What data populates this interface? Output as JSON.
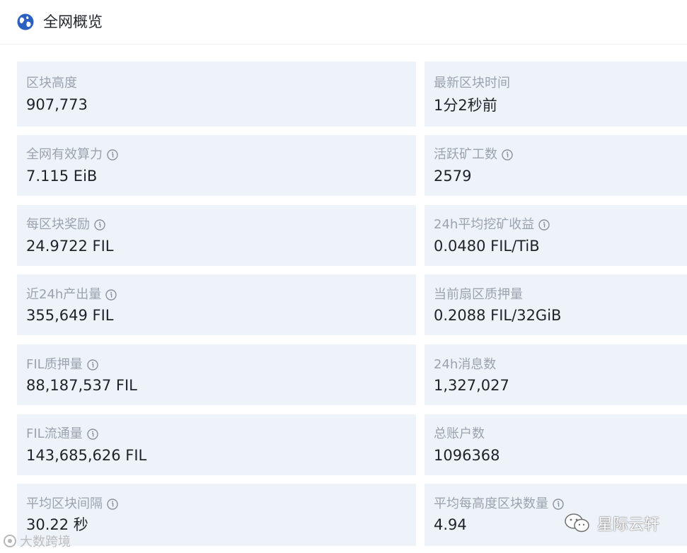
{
  "header": {
    "title": "全网概览",
    "icon": "globe-icon"
  },
  "cards": {
    "block_height": {
      "label": "区块高度",
      "value": "907,773"
    },
    "latest_block_time": {
      "label": "最新区块时间",
      "value": "1分2秒前"
    },
    "effective_power": {
      "label": "全网有效算力",
      "value": "7.115 EiB"
    },
    "active_miners": {
      "label": "活跃矿工数",
      "value": "2579"
    },
    "block_reward": {
      "label": "每区块奖励",
      "value": "24.9722 FIL"
    },
    "mining_yield_24h": {
      "label": "24h平均挖矿收益",
      "value": "0.0480 FIL/TiB"
    },
    "output_24h": {
      "label": "近24h产出量",
      "value": "355,649 FIL"
    },
    "sector_pledge": {
      "label": "当前扇区质押量",
      "value": "0.2088 FIL/32GiB"
    },
    "fil_pledge": {
      "label": "FIL质押量",
      "value": "88,187,537 FIL"
    },
    "messages_24h": {
      "label": "24h消息数",
      "value": "1,327,027"
    },
    "fil_circulating": {
      "label": "FIL流通量",
      "value": "143,685,626 FIL"
    },
    "total_accounts": {
      "label": "总账户数",
      "value": "1096368"
    },
    "avg_block_interval": {
      "label": "平均区块间隔",
      "value": "30.22 秒"
    },
    "avg_blocks_per_height": {
      "label": "平均每高度区块数量",
      "value": "4.94"
    }
  },
  "watermarks": {
    "left": "大数跨境",
    "right": "星际云轩"
  },
  "colors": {
    "card_bg": "#eef3fa",
    "label": "#9aa3ae",
    "value": "#1f2329",
    "globe": "#2b5fc0"
  }
}
